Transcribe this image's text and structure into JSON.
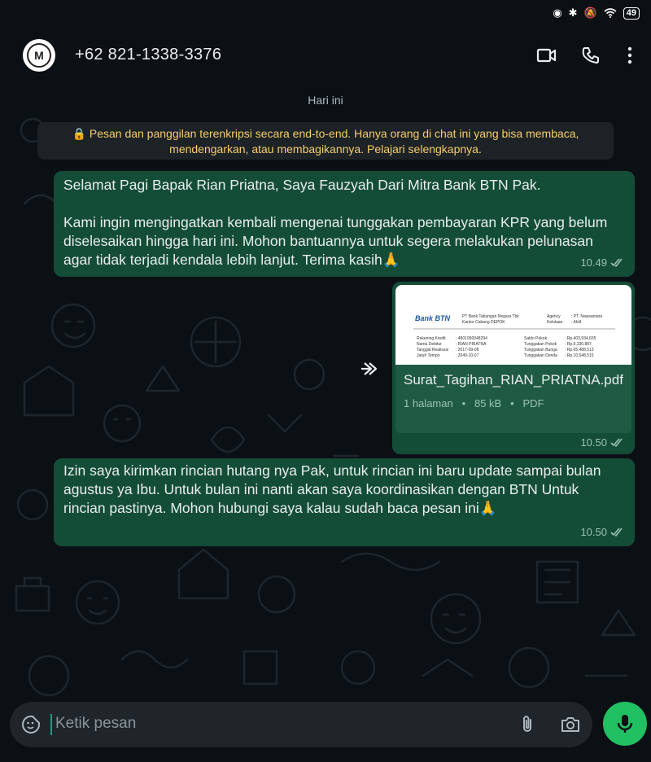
{
  "status_bar": {
    "battery": "49"
  },
  "header": {
    "contact_name": "+62 821-1338-3376",
    "avatar_letter": "M"
  },
  "chat": {
    "day_label": "Hari ini",
    "encryption_notice": "🔒 Pesan dan panggilan terenkripsi secara end-to-end. Hanya orang di chat ini yang bisa membaca, mendengarkan, atau membagikannya. Pelajari selengkapnya.",
    "messages": [
      {
        "paragraph1": "Selamat Pagi Bapak Rian Priatna, Saya Fauzyah Dari Mitra Bank BTN Pak.",
        "paragraph2": "Kami ingin mengingatkan kembali mengenai tunggakan pembayaran KPR yang belum diselesaikan hingga hari ini. Mohon bantuannya untuk segera melakukan pelunasan agar tidak terjadi kendala lebih lanjut. Terima kasih🙏",
        "time": "10.49"
      },
      {
        "document_name": "Surat_Tagihan_RIAN_PRIATNA.pdf",
        "pages": "1 halaman",
        "size": "85 kB",
        "type": "PDF",
        "time": "10.50",
        "preview": {
          "bank": "Bank BTN",
          "company": "PT Bank Tabungan Negara Tbk",
          "office": "Kantor Cabang DEPOK",
          "agency_label": "Agency",
          "agency_value": ": PT. Nawsantara",
          "kolek_label": "Kelolaan",
          "kolek_value": ": Aktif",
          "rows": [
            [
              "Rekening Kredit",
              ": 4801050048294",
              "Saldo Pokok",
              ": Rp.403,934,605"
            ],
            [
              "Nama Debitur",
              ": RIAN PRIATNA",
              "Tunggakan Pokok",
              ": Rp.9,330,887"
            ],
            [
              "Tanggal Realisasi",
              ": 2017-09-08",
              "Tunggakan Bunga",
              ": Rp.65,488,513"
            ],
            [
              "Jatuh Tempo",
              ": 2040-10-07",
              "Tunggakan Denda",
              ": Rp.10,548,515"
            ]
          ]
        }
      },
      {
        "text": "Izin saya kirimkan rincian hutang nya Pak, untuk rincian ini baru update sampai bulan agustus ya Ibu. Untuk bulan ini nanti akan saya koordinasikan dengan BTN Untuk rincian pastinya. Mohon hubungi saya kalau sudah baca pesan ini🙏",
        "time": "10.50"
      }
    ]
  },
  "input": {
    "placeholder": "Ketik pesan"
  },
  "icons": {
    "video": "video-call-icon",
    "call": "phone-icon",
    "menu": "more-vertical-icon",
    "emoji": "sticker-icon",
    "attach": "paperclip-icon",
    "camera": "camera-icon",
    "mic": "microphone-icon",
    "forward": "forward-icon",
    "read": "double-check-icon"
  },
  "colors": {
    "bubble": "#144d37",
    "accent": "#21c063",
    "notice": "#f7cd6b"
  }
}
